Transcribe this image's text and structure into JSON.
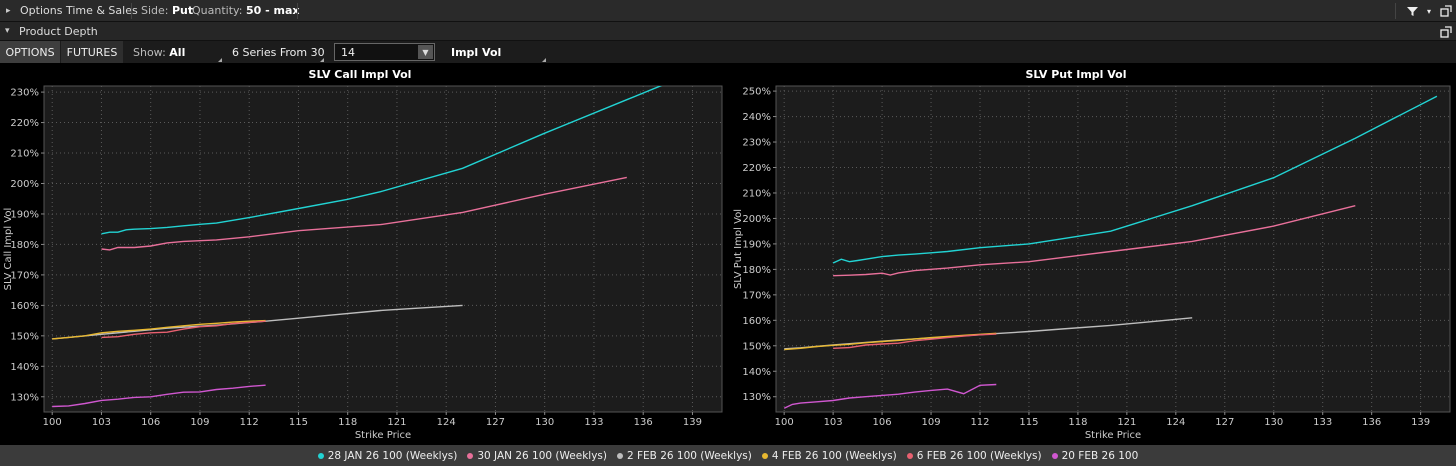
{
  "toolbar": {
    "title": "Options Time & Sales",
    "side_label": "Side:",
    "side_value": "Put",
    "quantity_label": "Quantity:",
    "quantity_value": "50 - max"
  },
  "section": {
    "title": "Product Depth"
  },
  "controls": {
    "options_tab": "OPTIONS",
    "futures_tab": "FUTURES",
    "show_label": "Show:",
    "show_value": "All",
    "series_select": "6 Series From 30",
    "days_value": "14",
    "metric_select": "Impl Vol"
  },
  "legend": {
    "items": [
      {
        "label": "28 JAN 26 100 (Weeklys)",
        "color": "#22d3d3"
      },
      {
        "label": "30 JAN 26 100 (Weeklys)",
        "color": "#e8709a"
      },
      {
        "label": "2 FEB 26 100 (Weeklys)",
        "color": "#bdbdbd"
      },
      {
        "label": "4 FEB 26 100 (Weeklys)",
        "color": "#e8b830"
      },
      {
        "label": "6 FEB 26 100 (Weeklys)",
        "color": "#e86070"
      },
      {
        "label": "20 FEB 26 100",
        "color": "#d057d0"
      }
    ]
  },
  "chart_data": [
    {
      "type": "line",
      "title": "SLV Call Impl Vol",
      "xlabel": "Strike Price",
      "ylabel": "SLV Call Impl Vol",
      "xlim": [
        99.5,
        140.8
      ],
      "ylim": [
        125,
        232
      ],
      "xticks": [
        100,
        103,
        106,
        109,
        112,
        115,
        118,
        121,
        124,
        127,
        130,
        133,
        136,
        139
      ],
      "yticks": [
        130,
        140,
        150,
        160,
        170,
        180,
        190,
        200,
        210,
        220,
        230
      ],
      "y_suffix": "%",
      "grid": true,
      "series": [
        {
          "name": "28 JAN 26 100 (Weeklys)",
          "color": "#22d3d3",
          "x": [
            103,
            103.5,
            104,
            104.5,
            105,
            106,
            107,
            108,
            109,
            110,
            112,
            115,
            118,
            120,
            125,
            130,
            135,
            140
          ],
          "y": [
            183.5,
            184,
            184,
            184.8,
            185,
            185.2,
            185.6,
            186.1,
            186.6,
            187,
            188.8,
            191.8,
            194.8,
            197.3,
            205,
            216.5,
            227.5,
            238.5
          ]
        },
        {
          "name": "30 JAN 26 100 (Weeklys)",
          "color": "#e8709a",
          "x": [
            103,
            103.5,
            104,
            105,
            106,
            107,
            108,
            110,
            112,
            115,
            120,
            125,
            130,
            135
          ],
          "y": [
            178.5,
            178.2,
            179,
            179,
            179.5,
            180.5,
            181,
            181.5,
            182.5,
            184.5,
            186.5,
            190.5,
            196.5,
            202
          ]
        },
        {
          "name": "2 FEB 26 100 (Weeklys)",
          "color": "#bdbdbd",
          "x": [
            100,
            101,
            103,
            105,
            107,
            110,
            113,
            115,
            117,
            120,
            122,
            125
          ],
          "y": [
            149,
            149.5,
            150.5,
            151.5,
            152.5,
            153.5,
            154.8,
            155.8,
            156.8,
            158.3,
            159,
            160
          ]
        },
        {
          "name": "4 FEB 26 100 (Weeklys)",
          "color": "#e8b830",
          "x": [
            100,
            101,
            102,
            103,
            104,
            105,
            106,
            107,
            108,
            109,
            110,
            111,
            112,
            113
          ],
          "y": [
            149,
            149.5,
            150,
            151,
            151.5,
            151.8,
            152.2,
            152.8,
            153.3,
            153.8,
            154.1,
            154.5,
            154.8,
            155
          ]
        },
        {
          "name": "6 FEB 26 100 (Weeklys)",
          "color": "#e86070",
          "x": [
            103,
            104,
            105,
            106,
            107,
            108,
            109,
            110,
            111,
            112,
            113
          ],
          "y": [
            149.5,
            149.7,
            150.5,
            151,
            151.2,
            152.2,
            153,
            153.3,
            154,
            154.4,
            154.8
          ]
        },
        {
          "name": "20 FEB 26 100",
          "color": "#d057d0",
          "x": [
            100,
            101,
            102,
            103,
            104,
            105,
            106,
            107,
            108,
            109,
            110,
            111,
            112,
            113
          ],
          "y": [
            126.8,
            127,
            127.8,
            128.8,
            129.2,
            129.8,
            130,
            130.8,
            131.5,
            131.6,
            132.4,
            132.8,
            133.4,
            133.8
          ]
        }
      ]
    },
    {
      "type": "line",
      "title": "SLV Put Impl Vol",
      "xlabel": "Strike Price",
      "ylabel": "SLV Put Impl Vol",
      "xlim": [
        99.5,
        140.8
      ],
      "ylim": [
        124,
        252
      ],
      "xticks": [
        100,
        103,
        106,
        109,
        112,
        115,
        118,
        121,
        124,
        127,
        130,
        133,
        136,
        139
      ],
      "yticks": [
        130,
        140,
        150,
        160,
        170,
        180,
        190,
        200,
        210,
        220,
        230,
        240,
        250
      ],
      "y_suffix": "%",
      "grid": true,
      "series": [
        {
          "name": "28 JAN 26 100 (Weeklys)",
          "color": "#22d3d3",
          "x": [
            103,
            103.5,
            104,
            104.5,
            105,
            106,
            107,
            108,
            109,
            110,
            112,
            115,
            118,
            120,
            125,
            130,
            135,
            140
          ],
          "y": [
            182.5,
            184,
            183,
            183.5,
            184,
            185,
            185.6,
            186,
            186.5,
            187,
            188.5,
            190,
            193,
            195,
            205,
            216,
            231.5,
            248
          ]
        },
        {
          "name": "30 JAN 26 100 (Weeklys)",
          "color": "#e8709a",
          "x": [
            103,
            104,
            105,
            106,
            106.5,
            107,
            108,
            110,
            112,
            115,
            120,
            125,
            130,
            135
          ],
          "y": [
            177.5,
            177.7,
            178,
            178.5,
            177.8,
            178.6,
            179.5,
            180.5,
            181.8,
            183,
            187,
            191,
            197,
            205
          ]
        },
        {
          "name": "2 FEB 26 100 (Weeklys)",
          "color": "#bdbdbd",
          "x": [
            100,
            101,
            103,
            105,
            107,
            110,
            113,
            115,
            117,
            120,
            122,
            125
          ],
          "y": [
            148.8,
            149.2,
            150.3,
            151.3,
            152.3,
            153.5,
            154.8,
            155.6,
            156.6,
            158,
            159.2,
            161
          ]
        },
        {
          "name": "4 FEB 26 100 (Weeklys)",
          "color": "#e8b830",
          "x": [
            100,
            101,
            102,
            103,
            104,
            105,
            106,
            107,
            108,
            109,
            110,
            111,
            112,
            113
          ],
          "y": [
            148.5,
            149,
            149.7,
            150.2,
            150.6,
            151.2,
            151.7,
            152.1,
            152.7,
            153.2,
            153.7,
            154.1,
            154.5,
            154.9
          ]
        },
        {
          "name": "6 FEB 26 100 (Weeklys)",
          "color": "#e86070",
          "x": [
            103,
            104,
            105,
            106,
            107,
            108,
            109,
            110,
            111,
            112,
            113
          ],
          "y": [
            149,
            149.3,
            150.3,
            150.7,
            151,
            152,
            152.6,
            153.2,
            153.8,
            154.3,
            154.6
          ]
        },
        {
          "name": "20 FEB 26 100",
          "color": "#d057d0",
          "x": [
            100,
            100.5,
            101,
            102,
            103,
            104,
            105,
            106,
            107,
            108,
            109,
            110,
            111,
            112,
            113
          ],
          "y": [
            125.5,
            127,
            127.5,
            128,
            128.5,
            129.5,
            130,
            130.5,
            131,
            131.8,
            132.5,
            133,
            131.2,
            134.5,
            134.8
          ]
        }
      ]
    }
  ]
}
